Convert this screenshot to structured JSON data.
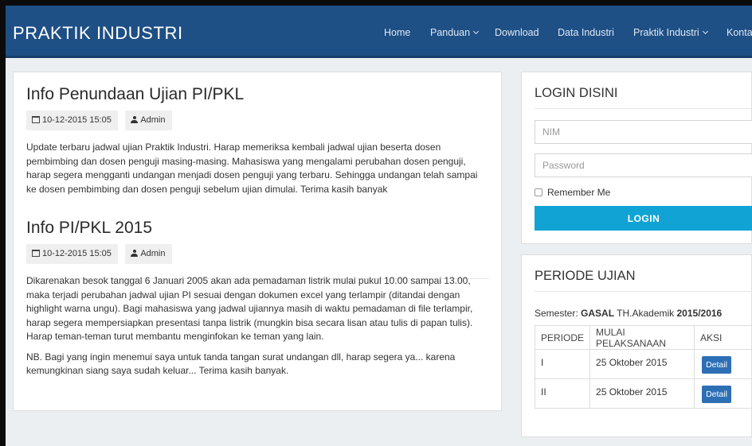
{
  "navbar": {
    "brand": "PRAKTIK INDUSTRI",
    "items": [
      {
        "label": "Home"
      },
      {
        "label": "Panduan",
        "dropdown": true
      },
      {
        "label": "Download"
      },
      {
        "label": "Data Industri"
      },
      {
        "label": "Praktik Industri",
        "dropdown": true
      },
      {
        "label": "Kontak"
      }
    ]
  },
  "posts": [
    {
      "title": "Info Penundaan Ujian PI/PKL",
      "date": "10-12-2015 15:05",
      "author": "Admin",
      "paragraphs": [
        "Update terbaru jadwal ujian Praktik Industri. Harap memeriksa kembali jadwal ujian beserta dosen pembimbing dan dosen penguji masing-masing. Mahasiswa yang mengalami perubahan dosen penguji, harap segera mengganti undangan menjadi dosen penguji yang terbaru. Sehingga undangan telah sampai ke dosen pembimbing dan dosen penguji sebelum ujian dimulai. Terima kasih banyak"
      ]
    },
    {
      "title": "Info PI/PKL 2015",
      "date": "10-12-2015 15:05",
      "author": "Admin",
      "paragraphs": [
        "Dikarenakan besok tanggal 6 Januari 2005 akan ada pemadaman listrik mulai pukul 10.00 sampai 13.00, maka terjadi perubahan jadwal ujian PI sesuai dengan dokumen excel yang terlampir (ditandai dengan highlight warna ungu). Bagi mahasiswa yang jadwal ujiannya masih di waktu pemadaman di file terlampir, harap segera mempersiapkan presentasi tanpa listrik (mungkin bisa secara lisan atau tulis di papan tulis). Harap teman-teman turut membantu menginfokan ke teman yang lain.",
        "NB. Bagi yang ingin menemui saya untuk tanda tangan surat undangan dll, harap segera ya... karena kemungkinan siang saya sudah keluar... Terima kasih banyak."
      ]
    }
  ],
  "login": {
    "title": "LOGIN DISINI",
    "nim_placeholder": "NIM",
    "password_placeholder": "Password",
    "remember_label": "Remember Me",
    "button_label": "LOGIN"
  },
  "periode": {
    "title": "PERIODE UJIAN",
    "semester_prefix": "Semester: ",
    "semester_value": "GASAL",
    "tahun_prefix": " TH.Akademik ",
    "tahun_value": "2015/2016",
    "columns": [
      "PERIODE",
      "MULAI PELAKSANAAN",
      "AKSI"
    ],
    "rows": [
      {
        "periode": "I",
        "mulai": "25 Oktober 2015",
        "aksi": "Detail"
      },
      {
        "periode": "II",
        "mulai": "25 Oktober 2015",
        "aksi": "Detail"
      }
    ]
  },
  "colors": {
    "navbar": "#1e4f85",
    "login_button": "#11a3d4",
    "detail_button": "#2d6fb5",
    "page_background": "#eceff1"
  },
  "icons": [
    "calendar-icon",
    "user-icon",
    "chevron-down-icon"
  ]
}
